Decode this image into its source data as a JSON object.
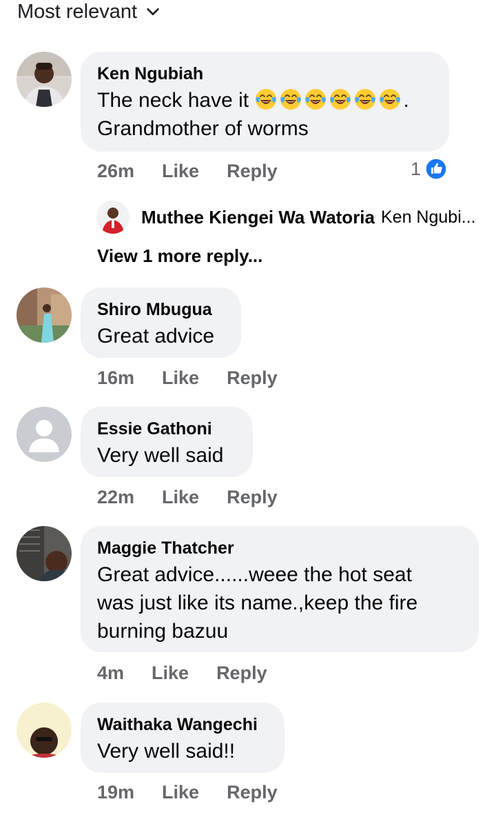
{
  "sort": {
    "label": "Most relevant"
  },
  "comments": [
    {
      "name": "Ken Ngubiah",
      "text_lines": [
        "The neck have it",
        "Grandmother of worms"
      ],
      "emoji_suffix": "😂😂😂😂😂😂.",
      "time": "26m",
      "like": "Like",
      "reply": "Reply",
      "reaction_count": "1"
    },
    {
      "name": "Shiro Mbugua",
      "text": "Great advice",
      "time": "16m",
      "like": "Like",
      "reply": "Reply"
    },
    {
      "name": "Essie Gathoni",
      "text": "Very well said",
      "time": "22m",
      "like": "Like",
      "reply": "Reply"
    },
    {
      "name": "Maggie Thatcher",
      "text_lines": [
        "Great advice......weee the hot seat",
        "was just like its name.,keep the fire",
        "burning bazuu"
      ],
      "time": "4m",
      "like": "Like",
      "reply": "Reply"
    },
    {
      "name": "Waithaka Wangechi",
      "text": "Very well said!!",
      "time": "19m",
      "like": "Like",
      "reply": "Reply"
    }
  ],
  "nested_reply": {
    "name": "Muthee Kiengei Wa Watoria",
    "snippet": "Ken Ngubi...",
    "more": "View 1 more reply..."
  },
  "icons": {
    "sort_chevron": "chevron-down-icon",
    "like_reaction": "thumbs-up-icon",
    "emoji": "tears-of-joy-emoji"
  },
  "colors": {
    "bubble": "#f0f2f5",
    "meta_text": "#65676b",
    "like_blue": "#1877f2"
  }
}
